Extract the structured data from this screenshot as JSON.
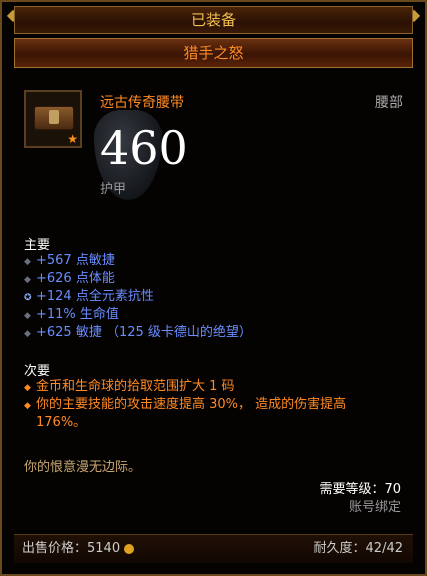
{
  "header": {
    "status": "已装备",
    "item_name": "猎手之怒"
  },
  "item": {
    "type": "远古传奇腰带",
    "slot": "腰部",
    "armor_value": "460",
    "armor_label": "护甲",
    "icon": "belt-icon"
  },
  "primary": {
    "title": "主要",
    "stats": [
      "+567 点敏捷",
      "+626 点体能",
      "+124 点全元素抗性",
      "+11% 生命值",
      "+625 敏捷 （125 级卡德山的绝望）"
    ]
  },
  "secondary": {
    "title": "次要",
    "stats": [
      "金币和生命球的拾取范围扩大 1 码",
      "你的主要技能的攻击速度提高 30%， 造成的伤害提高",
      "176%。"
    ]
  },
  "flavor": "你的恨意漫无边际。",
  "requirements": {
    "level_text": "需要等级：70",
    "bind_text": "账号绑定"
  },
  "footer": {
    "price_label": "出售价格：",
    "price_value": "5140",
    "durability_label": "耐久度：",
    "durability_value": "42/42"
  },
  "colors": {
    "legendary": "#ff8a24",
    "magic": "#6a8cff",
    "frame": "#6a4a1c"
  }
}
